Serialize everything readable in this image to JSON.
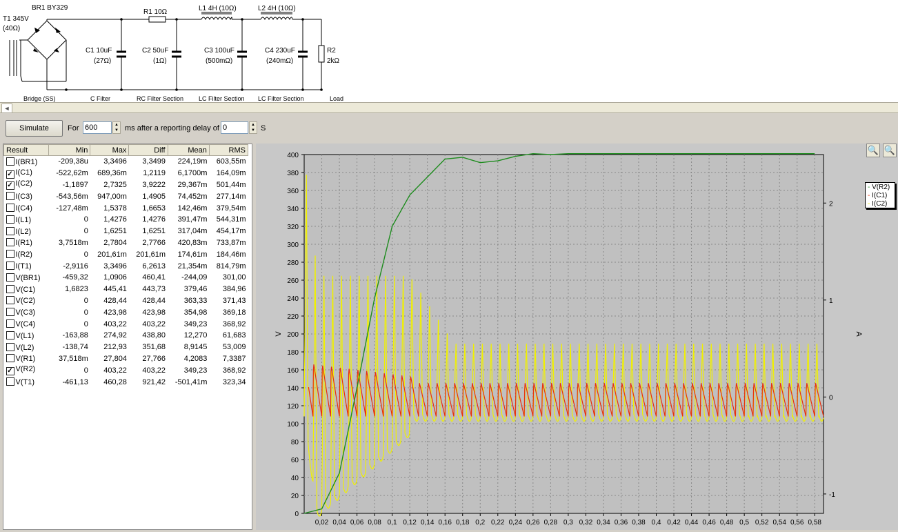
{
  "schematic": {
    "labels": {
      "br1": "BR1 BY329",
      "t1_name": "T1 345V",
      "t1_res": "(40Ω)",
      "r1": "R1 10Ω",
      "l1": "L1 4H (10Ω)",
      "l2": "L2 4H (10Ω)",
      "c1_name": "C1 10uF",
      "c1_res": "(27Ω)",
      "c2_name": "C2 50uF",
      "c2_res": "(1Ω)",
      "c3_name": "C3 100uF",
      "c3_res": "(500mΩ)",
      "c4_name": "C4 230uF",
      "c4_res": "(240mΩ)",
      "r2_name": "R2",
      "r2_res": "2kΩ"
    },
    "sections": [
      "Bridge (SS)",
      "C Filter",
      "RC Filter Section",
      "LC Filter Section",
      "LC Filter Section",
      "Load"
    ]
  },
  "toolbar": {
    "simulate_label": "Simulate",
    "for_label": "For",
    "duration_value": "600",
    "ms_label": "ms  after a reporting delay of",
    "delay_value": "0",
    "s_label": "S"
  },
  "results": {
    "columns": [
      "Result",
      "Min",
      "Max",
      "Diff",
      "Mean",
      "RMS"
    ],
    "rows": [
      {
        "name": "I(BR1)",
        "checked": false,
        "min": "-209,38u",
        "max": "3,3496",
        "diff": "3,3499",
        "mean": "224,19m",
        "rms": "603,55m"
      },
      {
        "name": "I(C1)",
        "checked": true,
        "min": "-522,62m",
        "max": "689,36m",
        "diff": "1,2119",
        "mean": "6,1700m",
        "rms": "164,09m"
      },
      {
        "name": "I(C2)",
        "checked": true,
        "min": "-1,1897",
        "max": "2,7325",
        "diff": "3,9222",
        "mean": "29,367m",
        "rms": "501,44m"
      },
      {
        "name": "I(C3)",
        "checked": false,
        "min": "-543,56m",
        "max": "947,00m",
        "diff": "1,4905",
        "mean": "74,452m",
        "rms": "277,14m"
      },
      {
        "name": "I(C4)",
        "checked": false,
        "min": "-127,48m",
        "max": "1,5378",
        "diff": "1,6653",
        "mean": "142,46m",
        "rms": "379,54m"
      },
      {
        "name": "I(L1)",
        "checked": false,
        "min": "0",
        "max": "1,4276",
        "diff": "1,4276",
        "mean": "391,47m",
        "rms": "544,31m"
      },
      {
        "name": "I(L2)",
        "checked": false,
        "min": "0",
        "max": "1,6251",
        "diff": "1,6251",
        "mean": "317,04m",
        "rms": "454,17m"
      },
      {
        "name": "I(R1)",
        "checked": false,
        "min": "3,7518m",
        "max": "2,7804",
        "diff": "2,7766",
        "mean": "420,83m",
        "rms": "733,87m"
      },
      {
        "name": "I(R2)",
        "checked": false,
        "min": "0",
        "max": "201,61m",
        "diff": "201,61m",
        "mean": "174,61m",
        "rms": "184,46m"
      },
      {
        "name": "I(T1)",
        "checked": false,
        "min": "-2,9116",
        "max": "3,3496",
        "diff": "6,2613",
        "mean": "21,354m",
        "rms": "814,79m"
      },
      {
        "name": "V(BR1)",
        "checked": false,
        "min": "-459,32",
        "max": "1,0906",
        "diff": "460,41",
        "mean": "-244,09",
        "rms": "301,00"
      },
      {
        "name": "V(C1)",
        "checked": false,
        "min": "1,6823",
        "max": "445,41",
        "diff": "443,73",
        "mean": "379,46",
        "rms": "384,96"
      },
      {
        "name": "V(C2)",
        "checked": false,
        "min": "0",
        "max": "428,44",
        "diff": "428,44",
        "mean": "363,33",
        "rms": "371,43"
      },
      {
        "name": "V(C3)",
        "checked": false,
        "min": "0",
        "max": "423,98",
        "diff": "423,98",
        "mean": "354,98",
        "rms": "369,18"
      },
      {
        "name": "V(C4)",
        "checked": false,
        "min": "0",
        "max": "403,22",
        "diff": "403,22",
        "mean": "349,23",
        "rms": "368,92"
      },
      {
        "name": "V(L1)",
        "checked": false,
        "min": "-163,88",
        "max": "274,92",
        "diff": "438,80",
        "mean": "12,270",
        "rms": "61,683"
      },
      {
        "name": "V(L2)",
        "checked": false,
        "min": "-138,74",
        "max": "212,93",
        "diff": "351,68",
        "mean": "8,9145",
        "rms": "53,009"
      },
      {
        "name": "V(R1)",
        "checked": false,
        "min": "37,518m",
        "max": "27,804",
        "diff": "27,766",
        "mean": "4,2083",
        "rms": "7,3387"
      },
      {
        "name": "V(R2)",
        "checked": true,
        "min": "0",
        "max": "403,22",
        "diff": "403,22",
        "mean": "349,23",
        "rms": "368,92"
      },
      {
        "name": "V(T1)",
        "checked": false,
        "min": "-461,13",
        "max": "460,28",
        "diff": "921,42",
        "mean": "-501,41m",
        "rms": "323,34"
      }
    ]
  },
  "icons": {
    "zoom_in": "magnifier-plus-icon",
    "zoom_out": "magnifier-minus-icon"
  },
  "chart_data": {
    "type": "line",
    "xlabel": "",
    "ylabel": "V",
    "y2label": "A",
    "xlim": [
      0,
      0.59
    ],
    "ylim": [
      0,
      400
    ],
    "y2lim": [
      -1.2,
      2.5
    ],
    "x_ticks": [
      "0,02",
      "0,04",
      "0,06",
      "0,08",
      "0,1",
      "0,12",
      "0,14",
      "0,16",
      "0,18",
      "0,2",
      "0,22",
      "0,24",
      "0,26",
      "0,28",
      "0,3",
      "0,32",
      "0,34",
      "0,36",
      "0,38",
      "0,4",
      "0,42",
      "0,44",
      "0,46",
      "0,48",
      "0,5",
      "0,52",
      "0,54",
      "0,56",
      "0,58"
    ],
    "y_ticks": [
      "0",
      "20",
      "40",
      "60",
      "80",
      "100",
      "120",
      "140",
      "160",
      "180",
      "200",
      "220",
      "240",
      "260",
      "280",
      "300",
      "320",
      "340",
      "360",
      "380",
      "400"
    ],
    "y2_ticks": [
      "-1",
      "0",
      "1",
      "2"
    ],
    "grid": true,
    "legend_position": "top-right",
    "colors": {
      "V(R2)": "#1e8c1e",
      "I(C1)": "#e8300c",
      "I(C2)": "#f0f000"
    },
    "series": [
      {
        "name": "V(R2)",
        "axis": "left",
        "x": [
          0,
          0.02,
          0.04,
          0.06,
          0.08,
          0.1,
          0.12,
          0.14,
          0.16,
          0.18,
          0.2,
          0.22,
          0.24,
          0.26,
          0.28,
          0.3,
          0.35,
          0.4,
          0.5,
          0.58
        ],
        "y": [
          0,
          5,
          45,
          140,
          240,
          320,
          355,
          375,
          395,
          397,
          391,
          393,
          398,
          401,
          400,
          401,
          401,
          401,
          401,
          401
        ]
      },
      {
        "name": "I(C1)",
        "axis": "right",
        "x_range": [
          0.005,
          0.59
        ],
        "period": 0.01,
        "envelope": "peaks about 0.6 A decaying to 0.25 A; troughs about -0.2 A",
        "start_peak": 0.6,
        "steady_peak": 0.25,
        "steady_trough": -0.2
      },
      {
        "name": "I(C2)",
        "axis": "right",
        "x_range": [
          0,
          0.59
        ],
        "period": 0.01,
        "envelope": "peaks up to 2.5 A at start then about 1.25 A until 0.12 then about 0.55 A; troughs down to -1.2 A early, about -0.2 A steady",
        "start_peak": 2.5,
        "mid_peak": 1.25,
        "steady_peak": 0.55,
        "start_trough": -1.2,
        "steady_trough": -0.2
      }
    ]
  }
}
